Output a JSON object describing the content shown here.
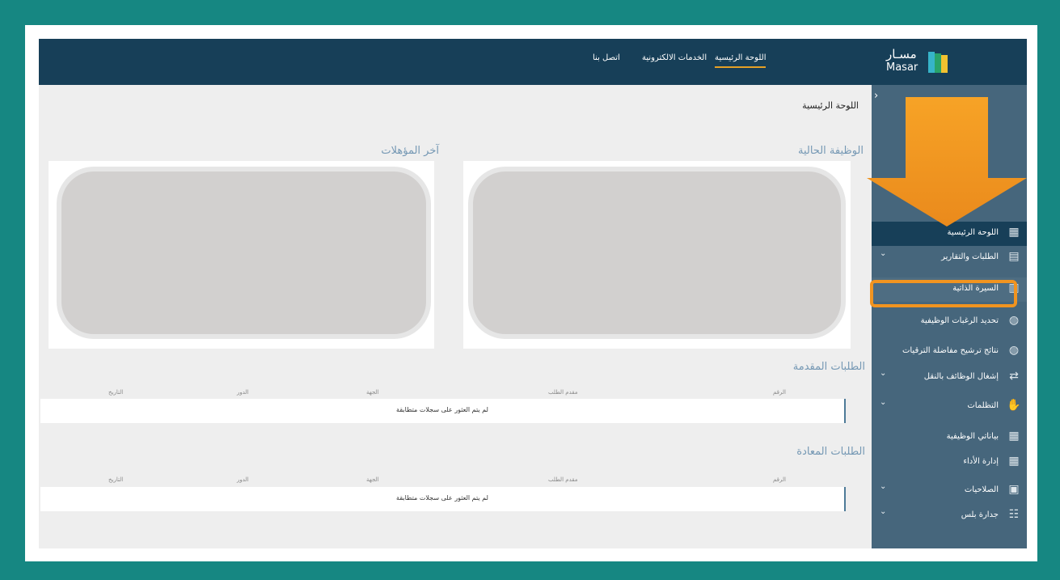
{
  "header": {
    "logo_ar": "مسـار",
    "logo_en": "Masar",
    "nav": [
      {
        "label": "اللوحة الرئيسية",
        "active": true
      },
      {
        "label": "الخدمات الالكترونية",
        "active": false
      },
      {
        "label": "اتصل بنا",
        "active": false
      }
    ]
  },
  "sidebar": {
    "collapse_icon": "chevron-right-icon",
    "items": [
      {
        "label": "اللوحة الرئيسية",
        "icon": "dashboard-icon",
        "has_caret": false,
        "state": "active"
      },
      {
        "label": "الطلبات والتقارير",
        "icon": "requests-icon",
        "has_caret": true,
        "state": ""
      },
      {
        "label": "السيرة الذاتية",
        "icon": "resume-icon",
        "has_caret": false,
        "state": "highlight"
      },
      {
        "label": "تحديد الرغبات الوظيفية",
        "icon": "user-settings-icon",
        "has_caret": false,
        "state": ""
      },
      {
        "label": "نتائج ترشيح مفاضلة الترقيات",
        "icon": "user-check-icon",
        "has_caret": false,
        "state": ""
      },
      {
        "label": "إشغال الوظائف بالنقل",
        "icon": "transfer-icon",
        "has_caret": true,
        "state": ""
      },
      {
        "label": "التظلمات",
        "icon": "hand-icon",
        "has_caret": true,
        "state": ""
      },
      {
        "label": "بياناتي الوظيفية",
        "icon": "job-data-icon",
        "has_caret": false,
        "state": ""
      },
      {
        "label": "إدارة الأداء",
        "icon": "performance-icon",
        "has_caret": false,
        "state": ""
      },
      {
        "label": "الصلاحيات",
        "icon": "permissions-icon",
        "has_caret": true,
        "state": ""
      },
      {
        "label": "جدارة بلس",
        "icon": "people-icon",
        "has_caret": true,
        "state": ""
      }
    ]
  },
  "main": {
    "page_title": "اللوحة الرئيسية",
    "current_job_title": "الوظيفة الحالية",
    "latest_qualifications_title": "آخر المؤهلات",
    "submitted_requests": {
      "title": "الطلبات المقدمة",
      "columns": [
        "الرقم",
        "مقدم الطلب",
        "الجهة",
        "الدور",
        "التاريخ"
      ],
      "empty_text": "لم يتم العثور على سجلات متطابقة"
    },
    "returned_requests": {
      "title": "الطلبات المعادة",
      "columns": [
        "الرقم",
        "مقدم الطلب",
        "الجهة",
        "الدور",
        "التاريخ"
      ],
      "empty_text": "لم يتم العثور على سجلات متطابقة"
    }
  },
  "colors": {
    "background": "#168782",
    "header": "#173f58",
    "sidebar": "#46667c",
    "accent": "#f19420",
    "section_title": "#7598b4"
  }
}
